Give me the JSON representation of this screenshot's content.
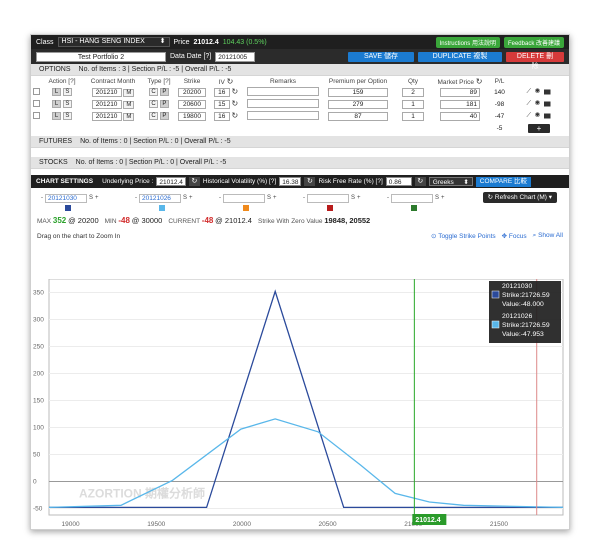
{
  "header": {
    "class_label": "Class",
    "class_value": "HSI - HANG SENG INDEX",
    "price_label": "Price",
    "price_value": "21012.4",
    "price_change": "104.43 (0.5%)",
    "instructions_btn": "Instructions 用法說明",
    "feedback_btn": "Feedback 改善建議"
  },
  "portfolio": {
    "name": "Test Portfolio 2",
    "date_label": "Data Date [?]",
    "date_value": "20121005",
    "save_btn": "SAVE 儲存",
    "duplicate_btn": "DUPLICATE 複製",
    "delete_btn": "DELETE 刪除"
  },
  "options": {
    "title": "OPTIONS",
    "summary": "No. of Items : 3 | Section P/L : -5 | Overall P/L : -5",
    "headers": [
      "Action [?]",
      "Contract Month",
      "Type [?]",
      "Strike",
      "IV",
      "Remarks",
      "Premium per Option",
      "Qty",
      "Market Price",
      "P/L"
    ],
    "rows": [
      {
        "l": "L",
        "s": "S",
        "month": "201210",
        "m": "M",
        "c": "C",
        "p": "P",
        "strike": "20200",
        "iv": "16",
        "remarks": "",
        "premium": "159",
        "qty": "2",
        "market": "89",
        "pl": "140"
      },
      {
        "l": "L",
        "s": "S",
        "month": "201210",
        "m": "M",
        "c": "C",
        "p": "P",
        "strike": "20600",
        "iv": "15",
        "remarks": "",
        "premium": "279",
        "qty": "1",
        "market": "181",
        "pl": "-98"
      },
      {
        "l": "L",
        "s": "S",
        "month": "201210",
        "m": "M",
        "c": "C",
        "p": "P",
        "strike": "19800",
        "iv": "16",
        "remarks": "",
        "premium": "87",
        "qty": "1",
        "market": "40",
        "pl": "-47"
      }
    ],
    "total_pl": "-5",
    "add_btn": "+"
  },
  "futures": {
    "title": "FUTURES",
    "summary": "No. of Items : 0 | Section P/L : 0 | Overall P/L : -5"
  },
  "stocks": {
    "title": "STOCKS",
    "summary": "No. of Items : 0 | Section P/L : 0 | Overall P/L : -5"
  },
  "chart_settings": {
    "title": "CHART SETTINGS",
    "underlying_label": "Underlying Price :",
    "underlying_value": "21012.4",
    "hv_label": "Historical Volatility (%) [?]",
    "hv_value": "16.38",
    "rf_label": "Risk Free Rate (%) [?]",
    "rf_value": "0.86",
    "greeks_value": "Greeks",
    "compare_btn": "COMPARE 比較"
  },
  "date_slots": [
    {
      "minus": "-",
      "value": "20121030",
      "s": "S",
      "plus": "+",
      "color": "#2b4a9b"
    },
    {
      "minus": "-",
      "value": "20121026",
      "s": "S",
      "plus": "+",
      "color": "#59b7ea"
    },
    {
      "minus": "-",
      "value": "",
      "s": "S",
      "plus": "+",
      "color": "#f08a1c"
    },
    {
      "minus": "-",
      "value": "",
      "s": "S",
      "plus": "+",
      "color": "#b81c1c"
    },
    {
      "minus": "-",
      "value": "",
      "s": "S",
      "plus": "+",
      "color": "#2c7a2c"
    }
  ],
  "refresh_chart": "Refresh Chart (M)",
  "stats": {
    "max_label": "MAX",
    "max_value": "352",
    "max_at": "@ 20200",
    "min_label": "MIN",
    "min_value": "-48",
    "min_at": "@ 30000",
    "current_label": "CURRENT",
    "current_value": "-48",
    "current_at": "@ 21012.4",
    "zero_label": "Strike With Zero Value",
    "zero_value": "19848, 20552"
  },
  "zoom": {
    "hint": "Drag on the chart to Zoom In",
    "toggle": "Toggle Strike Points",
    "focus": "Focus",
    "showall": "Show All"
  },
  "tooltip": {
    "s1_date": "20121030",
    "s1_strike": "Strike:21726.59",
    "s1_value": "Value:-48.000",
    "s2_date": "20121026",
    "s2_strike": "Strike:21726.59",
    "s2_value": "Value:-47.953"
  },
  "watermark": "AZORTION 期權分析師",
  "chart_data": {
    "type": "line",
    "x_ticks": [
      19000,
      19500,
      20000,
      20500,
      21000,
      21500
    ],
    "y_ticks": [
      -50,
      0,
      50,
      100,
      150,
      200,
      250,
      300,
      350
    ],
    "xlim": [
      18880,
      21880
    ],
    "ylim": [
      -62,
      375
    ],
    "current_marker": {
      "x": 21012.4,
      "label": "21012.4"
    },
    "second_marker": {
      "x": 21726.59
    },
    "series": [
      {
        "color": "#2b4a9b",
        "points": [
          [
            18880,
            -48
          ],
          [
            19800,
            -48
          ],
          [
            20200,
            352
          ],
          [
            20600,
            -48
          ],
          [
            21880,
            -48
          ]
        ]
      },
      {
        "color": "#59b7ea",
        "points": [
          [
            18880,
            -48
          ],
          [
            19300,
            -44
          ],
          [
            19600,
            2
          ],
          [
            20000,
            97
          ],
          [
            20200,
            116
          ],
          [
            20450,
            92
          ],
          [
            20700,
            30
          ],
          [
            20900,
            -22
          ],
          [
            21100,
            -38
          ],
          [
            21300,
            -44
          ],
          [
            21880,
            -48
          ]
        ]
      }
    ]
  }
}
